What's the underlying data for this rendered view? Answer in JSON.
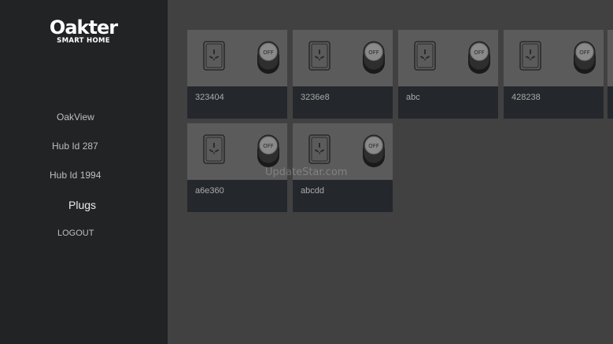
{
  "brand": {
    "name": "Oakter",
    "tagline": "SMART HOME"
  },
  "sidebar": {
    "items": [
      {
        "label": "OakView"
      },
      {
        "label": "Hub Id 287"
      },
      {
        "label": "Hub Id 1994"
      },
      {
        "label": "Plugs",
        "active": true
      },
      {
        "label": "LOGOUT"
      }
    ]
  },
  "plugs": [
    {
      "name": "323404",
      "state": "OFF"
    },
    {
      "name": "3236e8",
      "state": "OFF"
    },
    {
      "name": "abc",
      "state": "OFF"
    },
    {
      "name": "428238",
      "state": "OFF"
    },
    {
      "name": "a6e360",
      "state": "OFF"
    },
    {
      "name": "abcdd",
      "state": "OFF"
    }
  ],
  "watermark": "UpdateStar.com",
  "colors": {
    "background": "#414141",
    "sidebar": "#212325",
    "card_top": "#5b5b5b",
    "card_bottom": "#24282c"
  }
}
